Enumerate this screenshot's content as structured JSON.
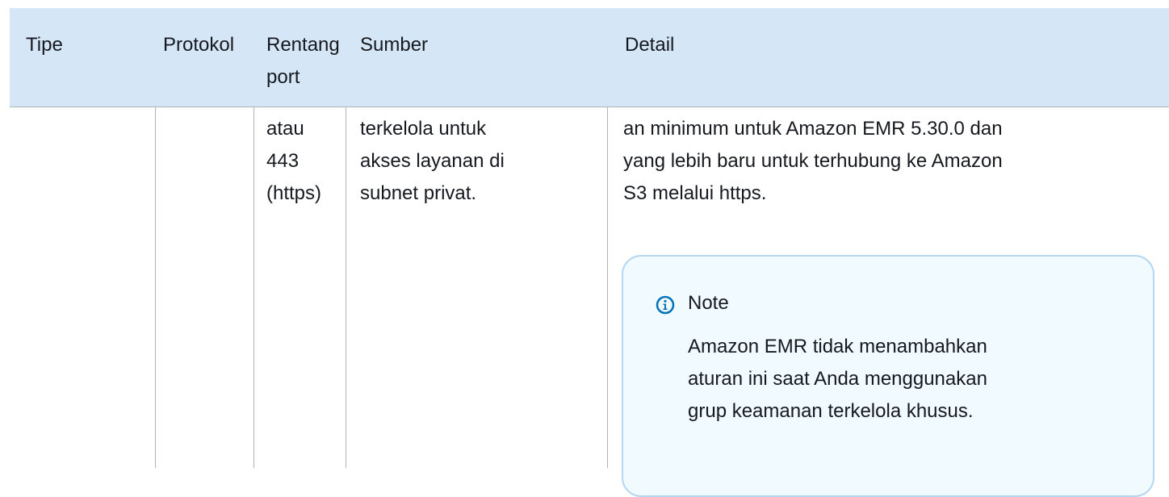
{
  "table": {
    "headers": {
      "tipe": "Tipe",
      "protokol": "Protokol",
      "rentang_port": "Rentang port",
      "sumber": "Sumber",
      "detail": "Detail"
    },
    "row": {
      "rentang_port_lines": [
        "atau",
        "443",
        "(https)"
      ],
      "sumber_lines": [
        "terkelola untuk",
        "akses layanan di",
        "subnet privat."
      ],
      "detail_lines": [
        "an minimum untuk Amazon EMR 5.30.0 dan",
        "yang lebih baru untuk terhubung ke Amazon",
        "S3 melalui https."
      ]
    },
    "note": {
      "title": "Note",
      "body_lines": [
        "Amazon EMR tidak menambahkan",
        "aturan ini saat Anda menggunakan",
        "grup keamanan terkelola khusus."
      ],
      "icon": "info-icon",
      "accent_color": "#0073bb"
    }
  }
}
